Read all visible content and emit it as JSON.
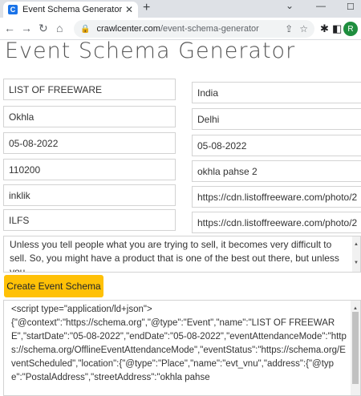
{
  "browser": {
    "tab_title": "Event Schema Generator tool",
    "favicon_letter": "C",
    "url_domain": "crawlcenter.com",
    "url_path": "/event-schema-generator",
    "profile_initial": "R"
  },
  "icons": {
    "back": "arrow-left-icon",
    "forward": "arrow-right-icon",
    "reload": "reload-icon",
    "home": "home-icon",
    "lock": "lock-icon",
    "share": "share-icon",
    "star": "star-icon",
    "extensions": "puzzle-icon",
    "sidebar": "sidebar-icon"
  },
  "page": {
    "title": "Event Schema Generator"
  },
  "form": {
    "event_name": "LIST OF FREEWARE",
    "country": "India",
    "locality": "Okhla",
    "region": "Delhi",
    "start_date": "05-08-2022",
    "end_date": "05-08-2022",
    "postal_code": "110200",
    "street_address": "okhla pahse 2",
    "performer": "inklik",
    "image_url_1": "https://cdn.listoffreeware.com/photo/2",
    "organizer": "ILFS",
    "image_url_2": "https://cdn.listoffreeware.com/photo/2",
    "description": "Unless you tell people what you are trying to sell, it becomes very difficult to sell. So, you might have a product that is one of the best out there, but unless you"
  },
  "button": {
    "create_label": "Create Event Schema"
  },
  "output": {
    "code": "<script type=\"application/ld+json\">\n{\"@context\":\"https://schema.org\",\"@type\":\"Event\",\"name\":\"LIST OF FREEWARE\",\"startDate\":\"05-08-2022\",\"endDate\":\"05-08-2022\",\"eventAttendanceMode\":\"https://schema.org/OfflineEventAttendanceMode\",\"eventStatus\":\"https://schema.org/EventScheduled\",\"location\":{\"@type\":\"Place\",\"name\":\"evt_vnu\",\"address\":{\"@type\":\"PostalAddress\",\"streetAddress\":\"okhla pahse"
  },
  "colors": {
    "button_bg": "#ffc107",
    "profile_bg": "#1e8e3e",
    "favicon_bg": "#1a73e8"
  }
}
